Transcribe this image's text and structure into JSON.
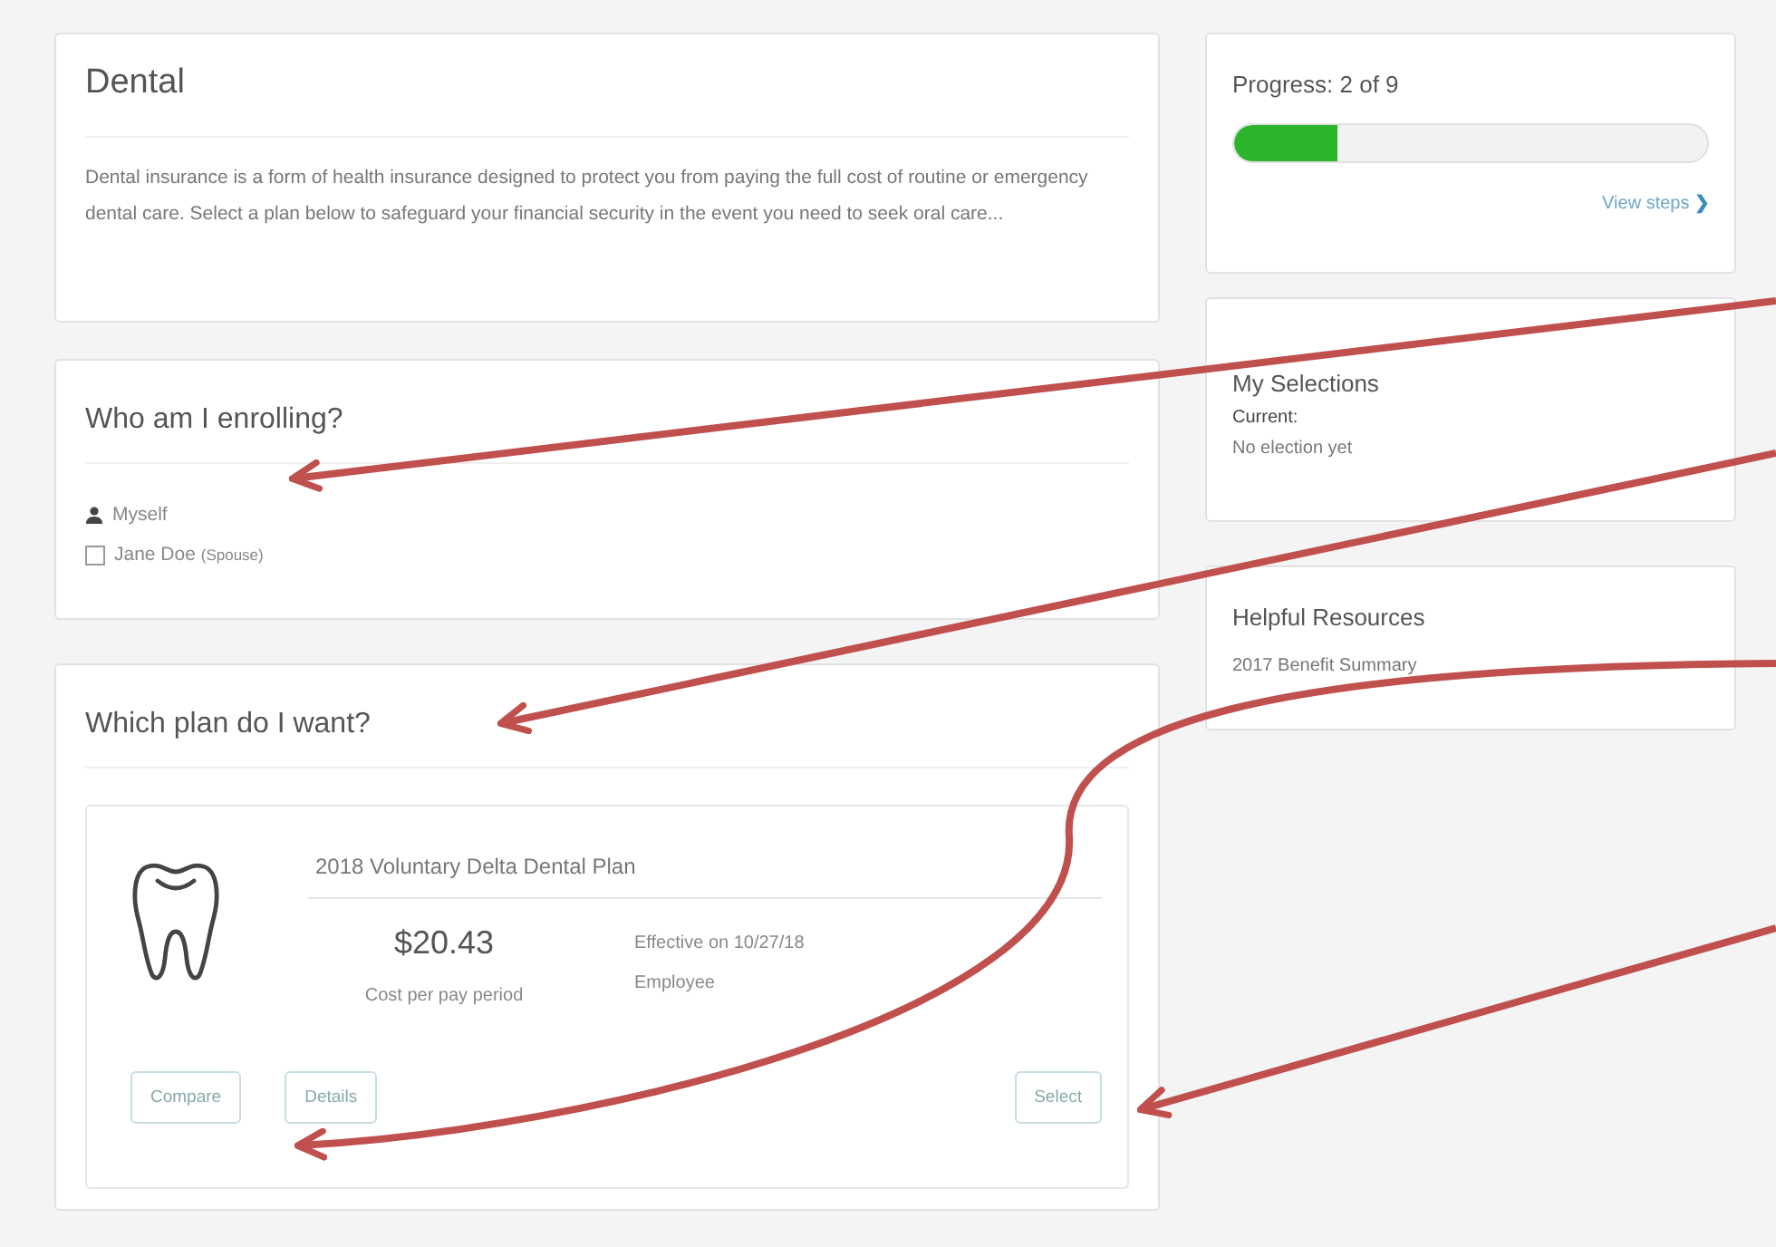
{
  "intro": {
    "title": "Dental",
    "description": "Dental insurance is a form of health insurance designed to protect you from paying the full cost of routine or emergency dental care. Select a plan below to safeguard your financial security in the event you need to seek oral care..."
  },
  "enrolling": {
    "title": "Who am I enrolling?",
    "members": [
      {
        "kind": "self",
        "label": "Myself"
      },
      {
        "kind": "dependent",
        "label": "Jane Doe",
        "relation": "(Spouse)",
        "checked": false
      }
    ]
  },
  "plans": {
    "title": "Which plan do I want?",
    "items": [
      {
        "name": "2018 Voluntary Delta Dental Plan",
        "price": "$20.43",
        "price_caption": "Cost per pay period",
        "effective": "Effective on 10/27/18",
        "coverage": "Employee",
        "buttons": [
          "Compare",
          "Details"
        ],
        "select_button": "Select"
      }
    ]
  },
  "progress": {
    "label": "Progress: 2 of 9",
    "level": 0.22,
    "link": "View steps",
    "link_icon": "❯"
  },
  "selections": {
    "title": "My Selections",
    "current_label": "Current:",
    "current_value": "No election yet"
  },
  "resources": {
    "title": "Helpful Resources",
    "links": [
      "2017 Benefit Summary"
    ]
  }
}
